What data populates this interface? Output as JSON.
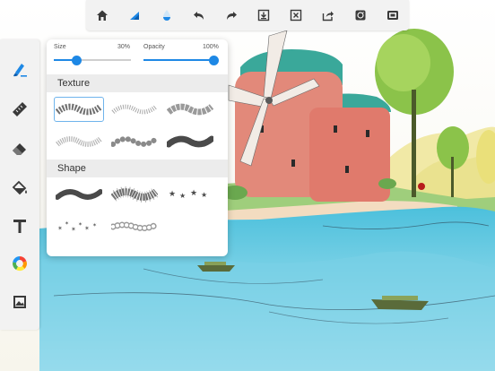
{
  "top_toolbar": {
    "icons": [
      "home-icon",
      "brush-size-icon",
      "ink-drop-icon",
      "undo-icon",
      "redo-icon",
      "import-icon",
      "close-layer-icon",
      "share-icon",
      "record-icon",
      "fullscreen-icon"
    ]
  },
  "left_toolbar": {
    "icons": [
      "brush-tool-icon",
      "ruler-icon",
      "eraser-icon",
      "fill-icon",
      "text-icon",
      "color-wheel-icon",
      "image-icon"
    ]
  },
  "brush_panel": {
    "size": {
      "label": "Size",
      "value_text": "30%",
      "value": 0.3
    },
    "opacity": {
      "label": "Opacity",
      "value_text": "100%",
      "value": 1.0
    },
    "sections": [
      {
        "title": "Texture",
        "brushes": [
          "texture-brush-checker",
          "texture-brush-dotted",
          "texture-brush-blocks",
          "texture-brush-dots-gray",
          "texture-brush-beads",
          "texture-brush-dark-beads"
        ]
      },
      {
        "title": "Shape",
        "brushes": [
          "shape-brush-stroke",
          "shape-brush-splat",
          "shape-brush-stars",
          "shape-brush-star-scatter",
          "shape-brush-circles"
        ]
      }
    ]
  },
  "colors": {
    "accent": "#1e88e5",
    "toolbar_bg": "#f2f2f2",
    "icon_dark": "#3a3a3a",
    "water": "#5fc8e0",
    "roof": "#3aa89a",
    "building": "#e2897a"
  }
}
